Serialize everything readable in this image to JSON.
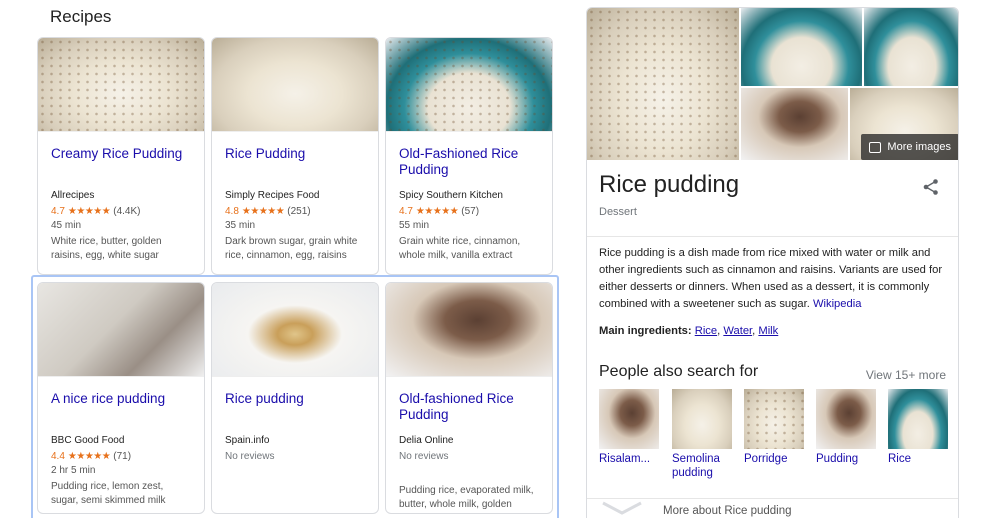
{
  "section_title": "Recipes",
  "recipes": [
    {
      "title": "Creamy Rice Pudding",
      "source": "Allrecipes",
      "rating": "4.7",
      "stars": "★★★★★",
      "reviews": "(4.4K)",
      "time": "45 min",
      "ingredients": "White rice, butter, golden raisins, egg, white sugar"
    },
    {
      "title": "Rice Pudding",
      "source": "Simply Recipes Food",
      "rating": "4.8",
      "stars": "★★★★★",
      "reviews": "(251)",
      "time": "35 min",
      "ingredients": "Dark brown sugar, grain white rice, cinnamon, egg, raisins"
    },
    {
      "title": "Old-Fashioned Rice Pudding",
      "source": "Spicy Southern Kitchen",
      "rating": "4.7",
      "stars": "★★★★★",
      "reviews": "(57)",
      "time": "55 min",
      "ingredients": "Grain white rice, cinnamon, whole milk, vanilla extract"
    },
    {
      "title": "A nice rice pudding",
      "source": "BBC Good Food",
      "rating": "4.4",
      "stars": "★★★★★",
      "reviews": "(71)",
      "time": "2 hr 5 min",
      "ingredients": "Pudding rice, lemon zest, sugar, semi skimmed milk"
    },
    {
      "title": "Rice pudding",
      "source": "Spain.info",
      "no_reviews": "No reviews"
    },
    {
      "title": "Old-fashioned Rice Pudding",
      "source": "Delia Online",
      "no_reviews": "No reviews",
      "ingredients": "Pudding rice, evaporated milk, butter, whole milk, golden"
    }
  ],
  "knowledge_panel": {
    "more_images": "More images",
    "title": "Rice pudding",
    "subtitle": "Dessert",
    "description": "Rice pudding is a dish made from rice mixed with water or milk and other ingredients such as cinnamon and raisins. Variants are used for either desserts or dinners. When used as a dessert, it is commonly combined with a sweetener such as sugar.",
    "source_link": "Wikipedia",
    "ingredients_label": "Main ingredients:",
    "ingredients": [
      "Rice",
      "Water",
      "Milk"
    ],
    "pasf_title": "People also search for",
    "pasf_more": "View 15+ more",
    "pasf_items": [
      "Risalam...",
      "Semolina pudding",
      "Porridge",
      "Pudding",
      "Rice"
    ],
    "more_about": "More about Rice pudding"
  }
}
